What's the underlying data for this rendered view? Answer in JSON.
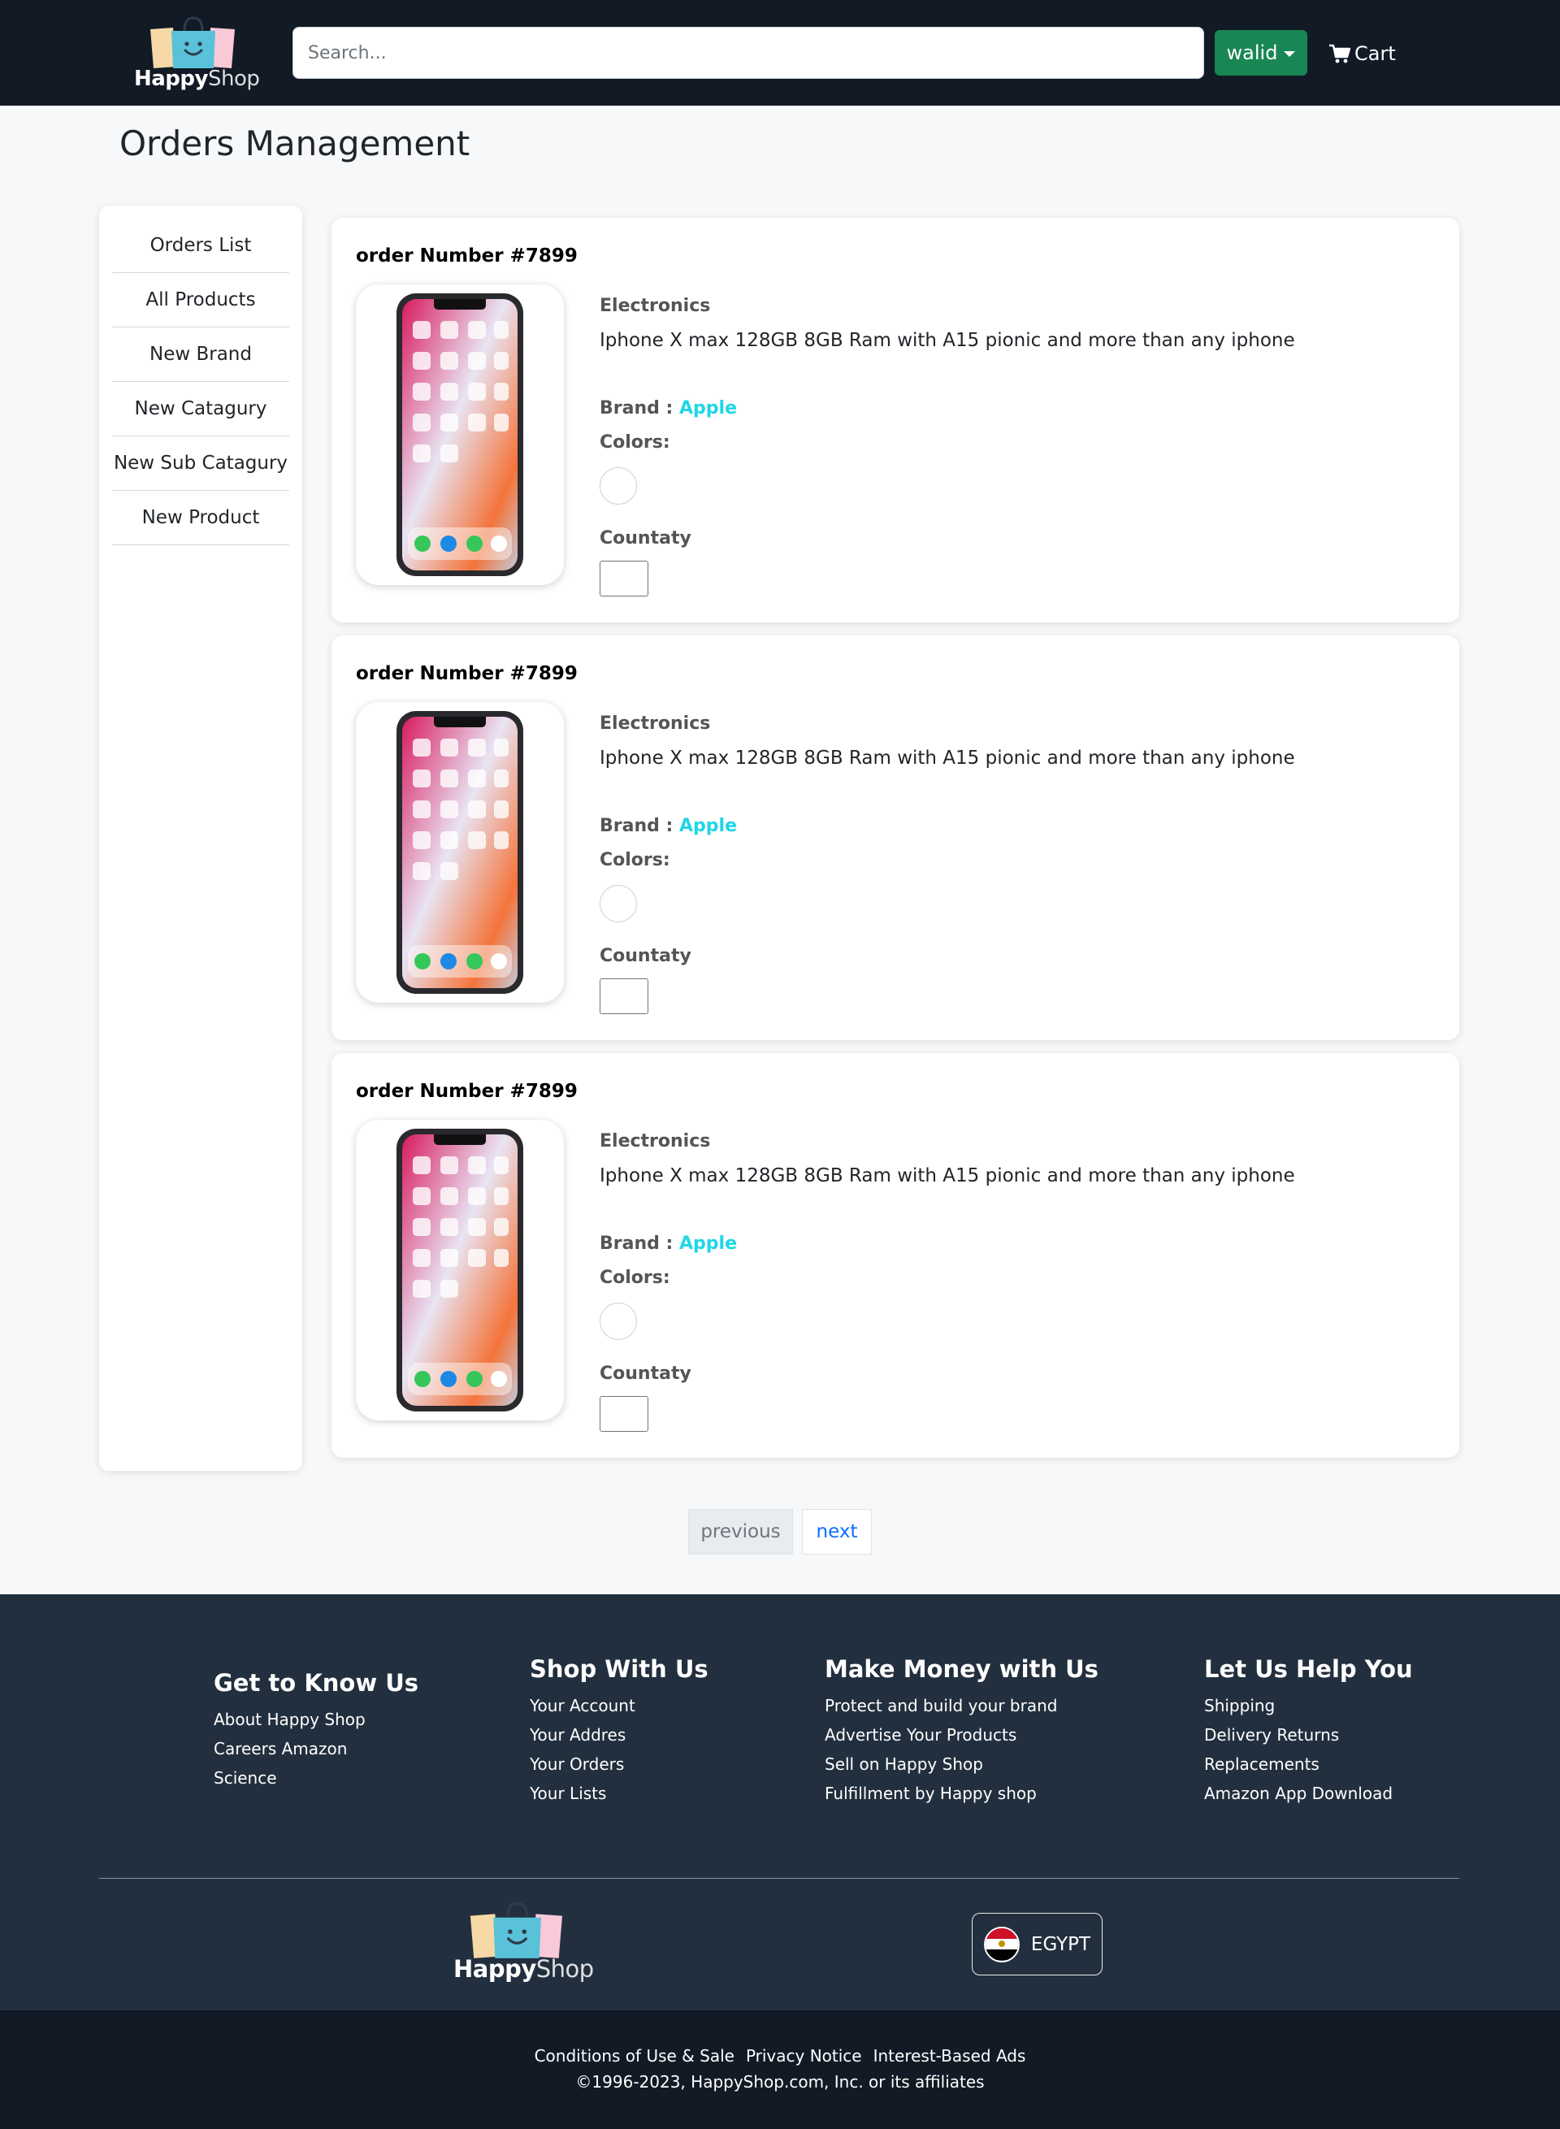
{
  "header": {
    "logo": {
      "word1": "Happy",
      "word2": "Shop"
    },
    "search_placeholder": "Search...",
    "user_label": "walid",
    "cart_label": "Cart"
  },
  "page_title": "Orders Management",
  "sidebar": {
    "items": [
      {
        "label": "Orders List"
      },
      {
        "label": "All Products"
      },
      {
        "label": "New Brand"
      },
      {
        "label": "New Catagury"
      },
      {
        "label": "New Sub Catagury"
      },
      {
        "label": "New Product"
      }
    ]
  },
  "orders": [
    {
      "number": "order Number #7899",
      "category": "Electronics",
      "title": "Iphone X max 128GB 8GB Ram with A15 pionic and more than any iphone",
      "brand_label": "Brand :",
      "brand": "Apple",
      "colors_label": "Colors:",
      "quantity_label": "Countaty"
    },
    {
      "number": "order Number #7899",
      "category": "Electronics",
      "title": "Iphone X max 128GB 8GB Ram with A15 pionic and more than any iphone",
      "brand_label": "Brand :",
      "brand": "Apple",
      "colors_label": "Colors:",
      "quantity_label": "Countaty"
    },
    {
      "number": "order Number #7899",
      "category": "Electronics",
      "title": "Iphone X max 128GB 8GB Ram with A15 pionic and more than any iphone",
      "brand_label": "Brand :",
      "brand": "Apple",
      "colors_label": "Colors:",
      "quantity_label": "Countaty"
    }
  ],
  "pagination": {
    "previous": "previous",
    "next": "next"
  },
  "footer": {
    "columns": [
      {
        "heading": "Get to Know Us",
        "links": [
          "About Happy Shop",
          "Careers Amazon",
          "Science"
        ]
      },
      {
        "heading": "Shop With Us",
        "links": [
          "Your Account",
          "Your Addres",
          "Your Orders",
          "Your Lists"
        ]
      },
      {
        "heading": "Make Money with Us",
        "links": [
          "Protect and build your brand",
          "Advertise Your Products",
          "Sell on Happy Shop",
          "Fulfillment by Happy shop"
        ]
      },
      {
        "heading": "Let Us Help You",
        "links": [
          "Shipping",
          "Delivery Returns",
          "Replacements",
          "Amazon App Download"
        ]
      }
    ],
    "logo": {
      "word1": "Happy",
      "word2": "Shop"
    },
    "country": "EGYPT",
    "bottom_links": [
      "Conditions of Use & Sale",
      "Privacy Notice",
      "Interest-Based Ads"
    ],
    "copyright": "©1996-2023, HappyShop.com, Inc. or its affiliates"
  },
  "colors": {
    "header_bg": "#121a26",
    "footer_bg": "#222f3e",
    "user_button": "#198754",
    "brand_accent": "#1fd6e6",
    "link_blue": "#0d6efd"
  }
}
